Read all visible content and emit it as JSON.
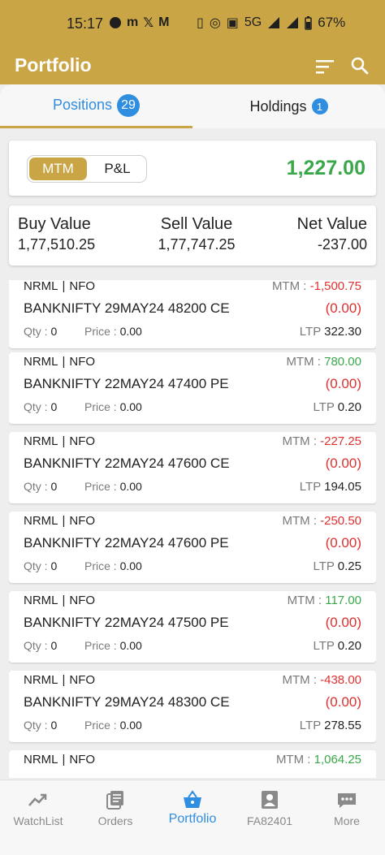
{
  "status_bar": {
    "time": "15:17",
    "network": "5G",
    "battery": "67%"
  },
  "app_bar": {
    "title": "Portfolio"
  },
  "tabs": [
    {
      "label": "Positions",
      "badge": "29"
    },
    {
      "label": "Holdings",
      "badge": "1"
    }
  ],
  "toggle": {
    "mtm_label": "MTM",
    "pnl_label": "P&L",
    "total": "1,227.00"
  },
  "summary": {
    "buy_label": "Buy Value",
    "buy_value": "1,77,510.25",
    "sell_label": "Sell Value",
    "sell_value": "1,77,747.25",
    "net_label": "Net Value",
    "net_value": "-237.00"
  },
  "labels": {
    "mtm": "MTM :",
    "qty": "Qty :",
    "price": "Price :",
    "ltp": "LTP",
    "separator": "|"
  },
  "positions": [
    {
      "product": "NRML",
      "exchange": "NFO",
      "mtm": "-1,500.75",
      "mtm_sign": "neg",
      "symbol": "BANKNIFTY 29MAY24 48200 CE",
      "pnl": "(0.00)",
      "qty": "0",
      "price": "0.00",
      "ltp": "322.30"
    },
    {
      "product": "NRML",
      "exchange": "NFO",
      "mtm": "780.00",
      "mtm_sign": "pos",
      "symbol": "BANKNIFTY 22MAY24 47400 PE",
      "pnl": "(0.00)",
      "qty": "0",
      "price": "0.00",
      "ltp": "0.20"
    },
    {
      "product": "NRML",
      "exchange": "NFO",
      "mtm": "-227.25",
      "mtm_sign": "neg",
      "symbol": "BANKNIFTY 22MAY24 47600 CE",
      "pnl": "(0.00)",
      "qty": "0",
      "price": "0.00",
      "ltp": "194.05"
    },
    {
      "product": "NRML",
      "exchange": "NFO",
      "mtm": "-250.50",
      "mtm_sign": "neg",
      "symbol": "BANKNIFTY 22MAY24 47600 PE",
      "pnl": "(0.00)",
      "qty": "0",
      "price": "0.00",
      "ltp": "0.25"
    },
    {
      "product": "NRML",
      "exchange": "NFO",
      "mtm": "117.00",
      "mtm_sign": "pos",
      "symbol": "BANKNIFTY 22MAY24 47500 PE",
      "pnl": "(0.00)",
      "qty": "0",
      "price": "0.00",
      "ltp": "0.20"
    },
    {
      "product": "NRML",
      "exchange": "NFO",
      "mtm": "-438.00",
      "mtm_sign": "neg",
      "symbol": "BANKNIFTY 29MAY24 48300 CE",
      "pnl": "(0.00)",
      "qty": "0",
      "price": "0.00",
      "ltp": "278.55"
    },
    {
      "product": "NRML",
      "exchange": "NFO",
      "mtm": "1,064.25",
      "mtm_sign": "pos",
      "symbol": "",
      "pnl": "",
      "qty": "",
      "price": "",
      "ltp": ""
    }
  ],
  "bottom_nav": [
    {
      "label": "WatchList",
      "icon": "trend-chart-icon"
    },
    {
      "label": "Orders",
      "icon": "orders-icon"
    },
    {
      "label": "Portfolio",
      "icon": "basket-icon",
      "active": true
    },
    {
      "label": "FA82401",
      "icon": "account-icon"
    },
    {
      "label": "More",
      "icon": "more-icon"
    }
  ],
  "colors": {
    "accent": "#c9a545",
    "blue": "#2f8ee0",
    "green": "#3aa84a",
    "red": "#e03030"
  }
}
